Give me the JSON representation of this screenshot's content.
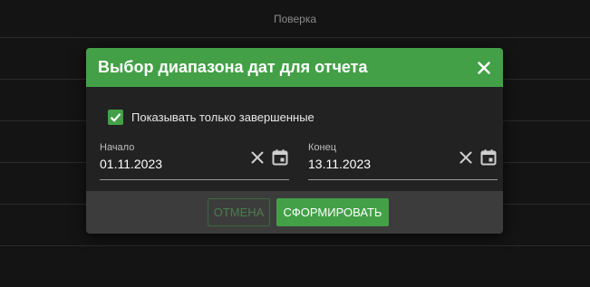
{
  "background": {
    "header_title": "Поверка"
  },
  "dialog": {
    "title": "Выбор диапазона дат для отчета",
    "close_icon": "close-icon",
    "checkbox": {
      "label": "Показывать только завершенные",
      "checked": true
    },
    "start_date": {
      "label": "Начало",
      "value": "01.11.2023",
      "clear_icon": "clear-icon",
      "calendar_icon": "calendar-icon"
    },
    "end_date": {
      "label": "Конец",
      "value": "13.11.2023",
      "clear_icon": "clear-icon",
      "calendar_icon": "calendar-icon"
    },
    "buttons": {
      "cancel": "ОТМЕНА",
      "submit": "СФОРМИРОВАТЬ"
    }
  },
  "colors": {
    "accent": "#43a047",
    "background": "#141414",
    "dialog_bg": "#222222",
    "footer_bg": "#3c3c3c"
  }
}
